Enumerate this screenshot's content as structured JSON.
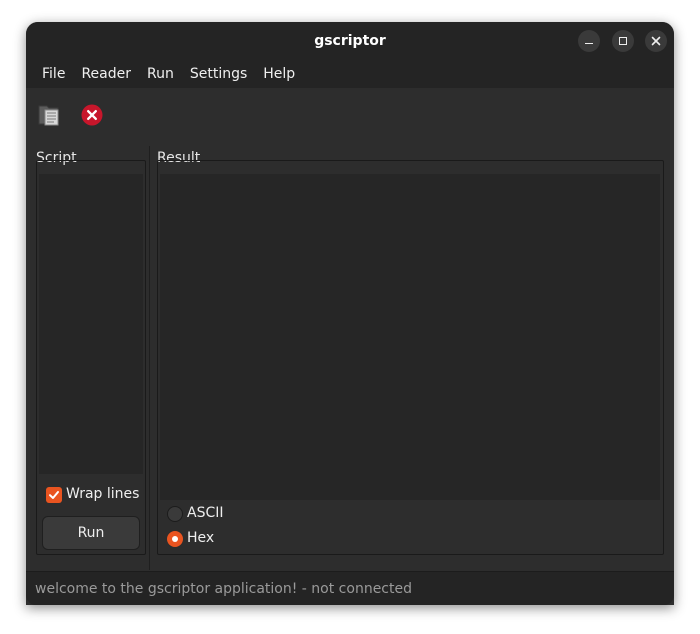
{
  "window": {
    "title": "gscriptor",
    "controls": {
      "minimize": "minimize-icon",
      "maximize": "maximize-icon",
      "close": "close-icon"
    }
  },
  "menubar": {
    "items": [
      {
        "label": "File"
      },
      {
        "label": "Reader"
      },
      {
        "label": "Run"
      },
      {
        "label": "Settings"
      },
      {
        "label": "Help"
      }
    ]
  },
  "toolbar": {
    "open_icon": "open-file-icon",
    "stop_icon": "stop-icon",
    "colors": {
      "stop": "#c7162b"
    }
  },
  "script_panel": {
    "label": "Script",
    "text": "",
    "wrap_lines": {
      "label": "Wrap lines",
      "checked": true
    },
    "run_button": {
      "label": "Run"
    }
  },
  "result_panel": {
    "label": "Result",
    "text": "",
    "format_options": [
      {
        "label": "ASCII",
        "selected": false
      },
      {
        "label": "Hex",
        "selected": true
      }
    ]
  },
  "statusbar": {
    "text": "welcome to the gscriptor application! - not connected"
  },
  "colors": {
    "accent": "#e95420",
    "window_bg": "#2d2d2d",
    "header_bg": "#242424"
  }
}
